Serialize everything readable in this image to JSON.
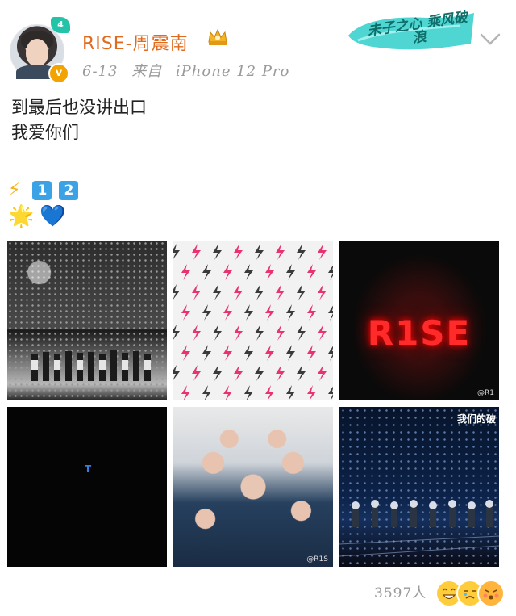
{
  "post": {
    "username": "RISE-周震南",
    "level_badge": "4",
    "verified_mark": "v",
    "date": "6-13",
    "source_prefix": "来自",
    "device": "iPhone 12 Pro",
    "banner_text": "未子之心 乘风破浪",
    "text_lines": [
      "到最后也没讲出口",
      "我爱你们"
    ],
    "emoji_line1": {
      "bolt": "⚡",
      "keycaps": [
        "1",
        "2"
      ]
    },
    "emoji_line2": {
      "star": "🌟",
      "heart": "💙"
    },
    "images": [
      {
        "name": "concert-stage",
        "watermark": ""
      },
      {
        "name": "lightning-pattern",
        "watermark": ""
      },
      {
        "name": "rise-neon",
        "label": "R1SE",
        "watermark": "@R1"
      },
      {
        "name": "dark-screen",
        "label": "T",
        "watermark": ""
      },
      {
        "name": "group-selfie",
        "watermark": "@R1S"
      },
      {
        "name": "stage-performance",
        "caption": "我们的破",
        "watermark": ""
      }
    ],
    "likes_count": "3597人",
    "reaction_icons": [
      "grin-icon",
      "cry-icon",
      "blush-icon"
    ]
  },
  "colors": {
    "username": "#e06b1e",
    "meta": "#9a9a9a",
    "level_badge": "#22c3a8",
    "verified": "#f2a300"
  }
}
